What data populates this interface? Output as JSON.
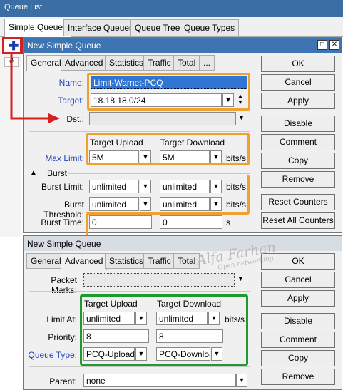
{
  "queue_list": {
    "title": "Queue List",
    "tabs": [
      "Simple Queues",
      "Interface Queues",
      "Queue Tree",
      "Queue Types"
    ],
    "add_button_icon": "plus-icon",
    "column_header": "#"
  },
  "window1": {
    "title": "New Simple Queue",
    "tabs": [
      "General",
      "Advanced",
      "Statistics",
      "Traffic",
      "Total",
      "..."
    ],
    "name_label": "Name:",
    "name_value": "Limit-Warnet-PCQ",
    "target_label": "Target:",
    "target_value": "18.18.18.0/24",
    "dst_label": "Dst.:",
    "target_upload_header": "Target Upload",
    "target_download_header": "Target Download",
    "max_limit_label": "Max Limit:",
    "max_limit_upload": "5M",
    "max_limit_download": "5M",
    "unit_bits": "bits/s",
    "burst_section": "Burst",
    "burst_limit_label": "Burst Limit:",
    "burst_limit_upload": "unlimited",
    "burst_limit_download": "unlimited",
    "burst_threshold_label": "Burst Threshold:",
    "burst_threshold_upload": "unlimited",
    "burst_threshold_download": "unlimited",
    "burst_time_label": "Burst Time:",
    "burst_time_upload": "0",
    "burst_time_download": "0",
    "unit_seconds": "s",
    "buttons": [
      "OK",
      "Cancel",
      "Apply",
      "Disable",
      "Comment",
      "Copy",
      "Remove",
      "Reset Counters",
      "Reset All Counters"
    ]
  },
  "window2": {
    "title": "New Simple Queue",
    "tabs": [
      "General",
      "Advanced",
      "Statistics",
      "Traffic",
      "Total"
    ],
    "packet_marks_label": "Packet Marks:",
    "target_upload_header": "Target Upload",
    "target_download_header": "Target Download",
    "limit_at_label": "Limit At:",
    "limit_at_upload": "unlimited",
    "limit_at_download": "unlimited",
    "unit_bits": "bits/s",
    "priority_label": "Priority:",
    "priority_upload": "8",
    "priority_download": "8",
    "queue_type_label": "Queue Type:",
    "queue_type_upload": "PCQ-Upload",
    "queue_type_download": "PCQ-Downloac",
    "parent_label": "Parent:",
    "parent_value": "none",
    "buttons": [
      "OK",
      "Cancel",
      "Apply",
      "Disable",
      "Comment",
      "Copy",
      "Remove"
    ]
  },
  "watermark": {
    "name": "Alfa Farhan",
    "tagline": "Open networking"
  },
  "colors": {
    "title_bar": "#3e74b1",
    "highlight_orange": "#f0a030",
    "highlight_green": "#1f9a2f",
    "highlight_red": "#d62020",
    "label_blue": "#1b3fc2"
  }
}
